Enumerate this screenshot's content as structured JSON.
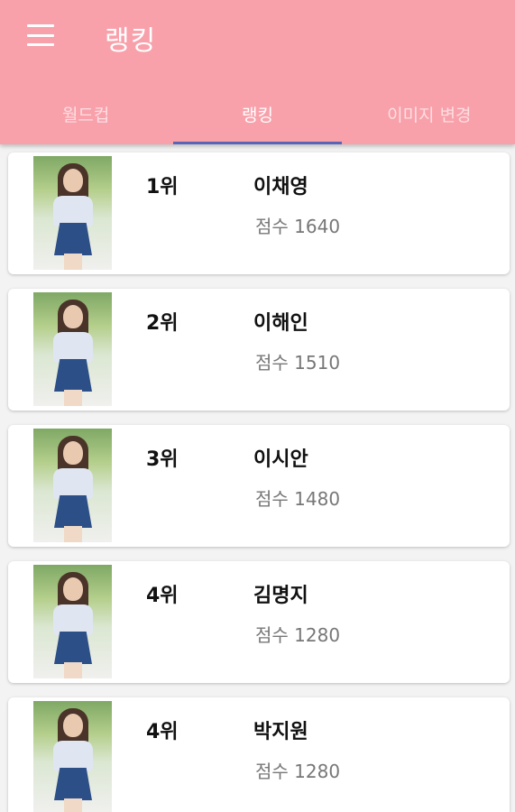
{
  "appbar": {
    "title": "랭킹",
    "menu_icon": "hamburger-menu-icon",
    "background": "#f8a1ab"
  },
  "tabs": [
    {
      "label": "월드컵",
      "active": false
    },
    {
      "label": "랭킹",
      "active": true
    },
    {
      "label": "이미지 변경",
      "active": false
    }
  ],
  "accent": "#5b63b7",
  "ranking": [
    {
      "rank": "1위",
      "name": "이채영",
      "score": "점수 1640"
    },
    {
      "rank": "2위",
      "name": "이해인",
      "score": "점수 1510"
    },
    {
      "rank": "3위",
      "name": "이시안",
      "score": "점수 1480"
    },
    {
      "rank": "4위",
      "name": "김명지",
      "score": "점수 1280"
    },
    {
      "rank": "4위",
      "name": "박지원",
      "score": "점수 1280"
    }
  ]
}
